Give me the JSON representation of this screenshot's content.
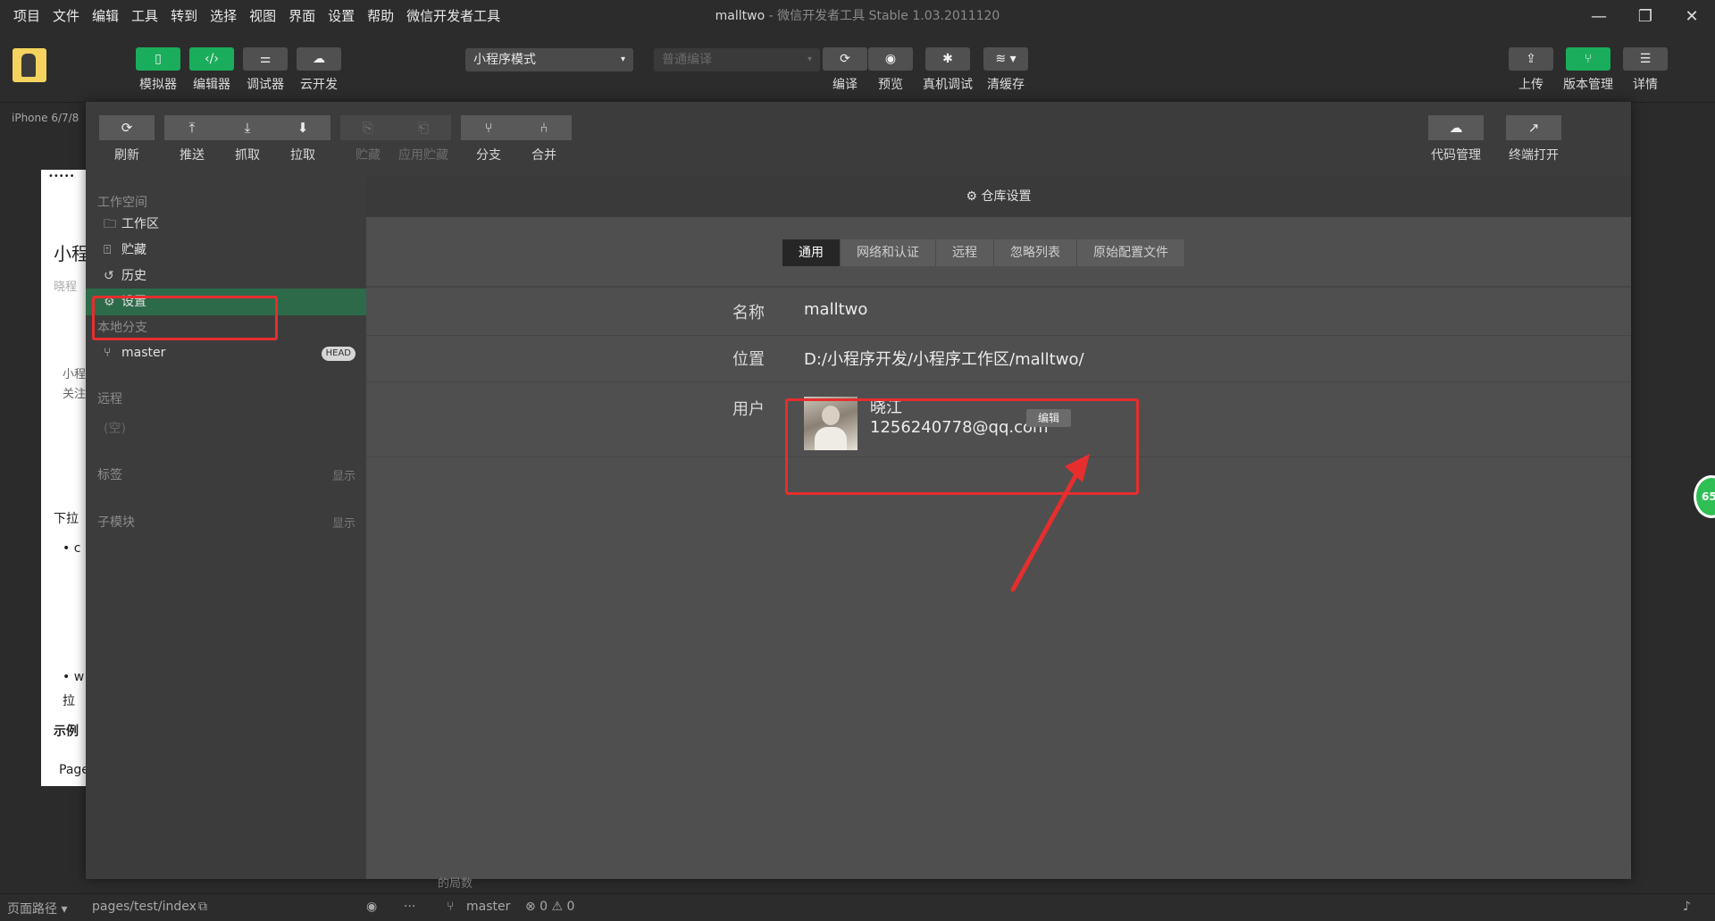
{
  "menubar": {
    "items": [
      "项目",
      "文件",
      "编辑",
      "工具",
      "转到",
      "选择",
      "视图",
      "界面",
      "设置",
      "帮助",
      "微信开发者工具"
    ],
    "title_project": "malltwo",
    "title_rest": " - 微信开发者工具 Stable 1.03.2011120",
    "window_controls": [
      "—",
      "❐",
      "✕"
    ]
  },
  "toolbar": {
    "simulator": "模拟器",
    "editor": "编辑器",
    "debugger": "调试器",
    "cloud": "云开发",
    "mode_select": "小程序模式",
    "compile_select_placeholder": "普通编译",
    "compile": "编译",
    "preview": "预览",
    "real_debug": "真机调试",
    "clear_cache": "清缓存",
    "upload": "上传",
    "version": "版本管理",
    "details": "详情"
  },
  "simulator": {
    "device": "iPhone 6/7/8",
    "phone_texts": [
      "•••••",
      "小程",
      "晓程",
      "小程",
      "关注",
      "下拉",
      "•  c",
      "•  w",
      "  拉",
      "示例",
      "Page"
    ]
  },
  "git_toolbar": {
    "refresh": "刷新",
    "push": "推送",
    "fetch": "抓取",
    "pull": "拉取",
    "stash": "贮藏",
    "apply_stash": "应用贮藏",
    "branch": "分支",
    "merge": "合并",
    "code_mgmt": "代码管理",
    "terminal": "终端打开"
  },
  "git_sidebar": {
    "workspace_title": "工作空间",
    "workspace_items": [
      "工作区",
      "贮藏",
      "历史",
      "设置"
    ],
    "local_branch_title": "本地分支",
    "branch_name": "master",
    "head_badge": "HEAD",
    "remote_title": "远程",
    "remote_empty": "(空)",
    "tags_title": "标签",
    "tags_show": "显示",
    "submodule_title": "子模块",
    "submodule_show": "显示"
  },
  "repo_settings": {
    "header": "仓库设置",
    "tabs": [
      "通用",
      "网络和认证",
      "远程",
      "忽略列表",
      "原始配置文件"
    ],
    "name_label": "名称",
    "name_value": "malltwo",
    "location_label": "位置",
    "location_value": "D:/小程序开发/小程序工作区/malltwo/",
    "user_label": "用户",
    "user_name": "晓江",
    "user_email": "1256240778@qq.com",
    "edit_button": "编辑"
  },
  "statusbar": {
    "page_path_label": "页面路径 ▾",
    "page_path": "pages/test/index",
    "branch": "master",
    "errors": "⊗ 0 ⚠ 0",
    "more": "···",
    "behind_text": "的局数"
  },
  "floating_badge": "65",
  "colors": {
    "accent_green": "#1aad5b",
    "annotation_red": "#e62e2e",
    "active_sidebar": "#2d6a4a"
  }
}
